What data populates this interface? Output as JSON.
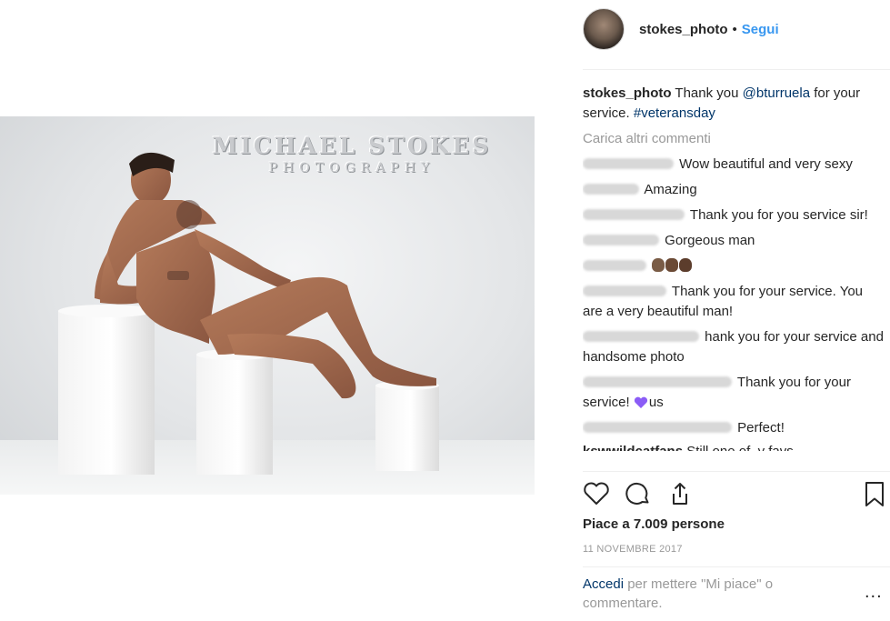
{
  "post": {
    "watermark_line1": "MICHAEL STOKES",
    "watermark_line2": "PHOTOGRAPHY"
  },
  "header": {
    "username": "stokes_photo",
    "separator": "•",
    "follow_label": "Segui"
  },
  "caption": {
    "username": "stokes_photo",
    "text_before": "Thank you",
    "mention": "@bturruela",
    "text_after": "for your service.",
    "hashtag": "#veteransday"
  },
  "load_more_label": "Carica altri commenti",
  "comments": [
    {
      "text": "Wow beautiful and very sexy"
    },
    {
      "text": "Amazing"
    },
    {
      "text": "Thank you for you service sir!"
    },
    {
      "text": "Gorgeous man"
    },
    {
      "text": ""
    },
    {
      "text": "Thank you for your service. You are a very beautiful man!"
    },
    {
      "text": "hank you for your service and handsome photo"
    },
    {
      "text": "Thank you for your service!",
      "text_tail": "us"
    },
    {
      "text": "Perfect!"
    },
    {
      "username": "kswwildcatfans",
      "text": "Still one of .y favs"
    }
  ],
  "actions": {
    "like_icon": "heart-icon",
    "comment_icon": "comment-icon",
    "share_icon": "share-icon",
    "save_icon": "bookmark-icon"
  },
  "likes_text": "Piace a 7.009 persone",
  "date_text": "11 NOVEMBRE 2017",
  "login_prompt": {
    "link": "Accedi",
    "text": "per mettere \"Mi piace\" o commentare."
  },
  "more_options": "..."
}
